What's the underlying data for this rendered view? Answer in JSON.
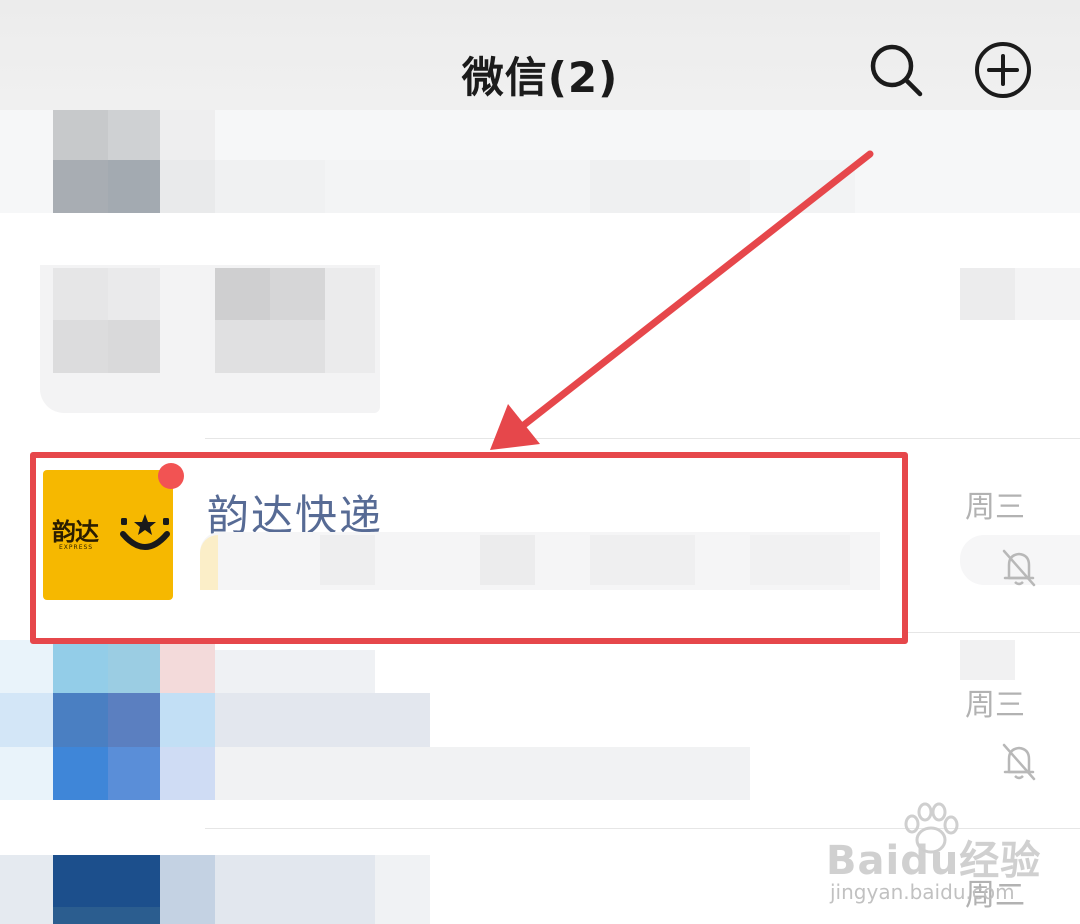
{
  "header": {
    "title": "微信(2)",
    "search_icon": "search-icon",
    "add_icon": "plus-circle-icon"
  },
  "chat": {
    "name": "韵达快递",
    "time": "周三",
    "avatar_text": "韵达",
    "avatar_sub": "EXPRESS",
    "unread": true,
    "mute_icon": "bell-muted-icon"
  },
  "other_rows": {
    "time_2": "周三",
    "time_3": "周二"
  },
  "watermark": {
    "main": "Baidu经验",
    "sub": "jingyan.baidu.com"
  },
  "colors": {
    "header_bg": "#ececec",
    "highlight": "#e6474b",
    "unread_dot": "#f25353",
    "name_color": "#576b95",
    "avatar_bg": "#f6b800"
  }
}
